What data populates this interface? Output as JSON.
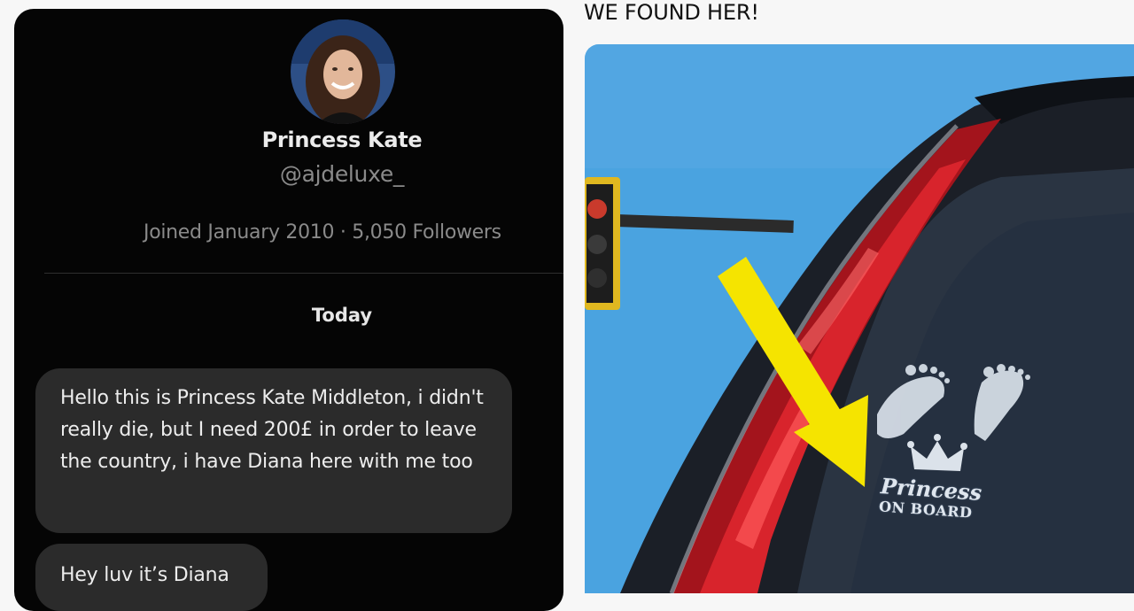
{
  "left_panel": {
    "profile": {
      "name": "Princess Kate",
      "handle": "@ajdeluxe_",
      "joined": "Joined January 2010",
      "separator": "·",
      "followers": "5,050 Followers"
    },
    "day_label": "Today",
    "messages": [
      "Hello this is Princess Kate Middleton, i didn't really die, but I need 200£ in order to leave the country, i have Diana here with me too",
      "Hey luv it’s Diana"
    ]
  },
  "right_panel": {
    "caption": "WE FOUND HER!",
    "decal": {
      "line1": "Princess",
      "line2": "ON BOARD"
    },
    "arrow_color": "#f5e400",
    "sky_color": "#4aa3e0"
  }
}
